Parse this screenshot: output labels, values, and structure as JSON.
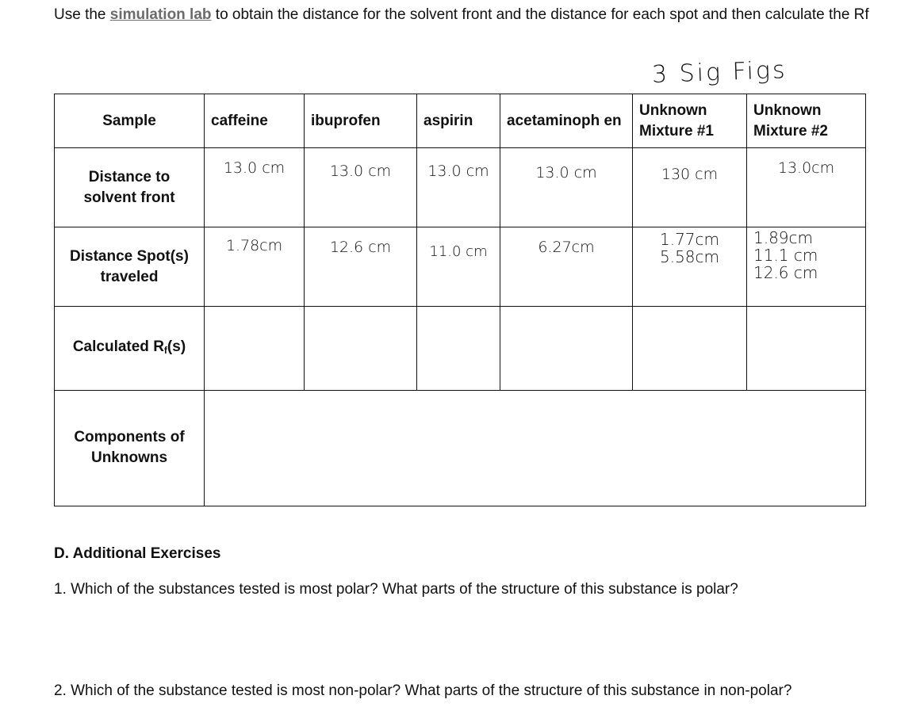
{
  "intro": {
    "prefix": "Use the ",
    "link_text": "simulation lab",
    "suffix": " to obtain the distance for the solvent front and the distance for each spot and then calculate the Rf"
  },
  "annotation": "3 Sig Figs",
  "table": {
    "header": {
      "sample_label": "Sample",
      "columns": [
        "caffeine",
        "ibuprofen",
        "aspirin",
        "acetaminoph en",
        "Unknown Mixture #1",
        "Unknown Mixture #2"
      ]
    },
    "rows": {
      "solvent_front": {
        "label": "Distance to solvent front",
        "values": [
          "13.0 cm",
          "13.0 cm",
          "13.0 cm",
          "13.0 cm",
          "130 cm",
          "13.0cm"
        ]
      },
      "spot_distance": {
        "label": "Distance Spot(s) traveled",
        "values": [
          [
            "1.78cm"
          ],
          [
            "12.6 cm"
          ],
          [
            "11.0 cm"
          ],
          [
            "6.27cm"
          ],
          [
            "1.77cm",
            "5.58cm"
          ],
          [
            "1.89cm",
            "11.1 cm",
            "12.6 cm"
          ]
        ]
      },
      "rf": {
        "label_main": "Calculated R",
        "label_sub": "f",
        "label_end": "(s)",
        "values": [
          "",
          "",
          "",
          "",
          "",
          ""
        ]
      },
      "components": {
        "label": "Components of Unknowns",
        "value": ""
      }
    }
  },
  "section_d": {
    "title": "D.  Additional Exercises",
    "questions": [
      "1. Which of the substances tested is most polar? What parts of the structure of this substance is polar?",
      "2. Which of the substance tested is most non-polar? What parts of the structure of this substance in non-polar?"
    ]
  }
}
